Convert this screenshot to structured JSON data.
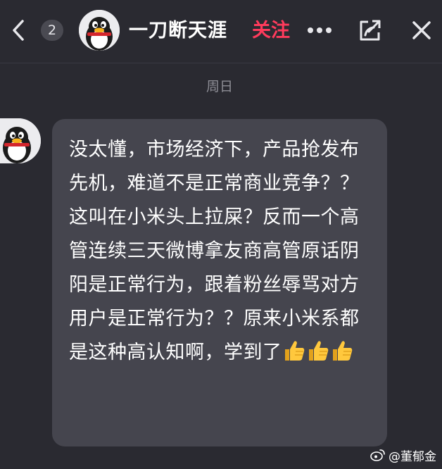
{
  "header": {
    "unread_count": "2",
    "contact_name": "一刀断天涯",
    "follow_label": "关注"
  },
  "date_divider": "周日",
  "message": {
    "text": "没太懂，市场经济下，产品抢发布先机，难道不是正常商业竞争？？这叫在小米头上拉屎？反而一个高管连续三天微博拿友商高管原话阴阳是正常行为，跟着粉丝辱骂对方用户是正常行为？？原来小米系都是这种高认知啊，学到了"
  },
  "watermark": "@董郁金",
  "colors": {
    "background": "#2a2a31",
    "bubble": "#45454e",
    "follow_accent": "#ff3b5c",
    "timestamp": "#8e8e96"
  },
  "icons": [
    "back-chevron-icon",
    "more-dots-icon",
    "share-icon",
    "close-icon",
    "penguin-avatar",
    "thumbs-up-emoji",
    "weibo-logo-icon"
  ]
}
